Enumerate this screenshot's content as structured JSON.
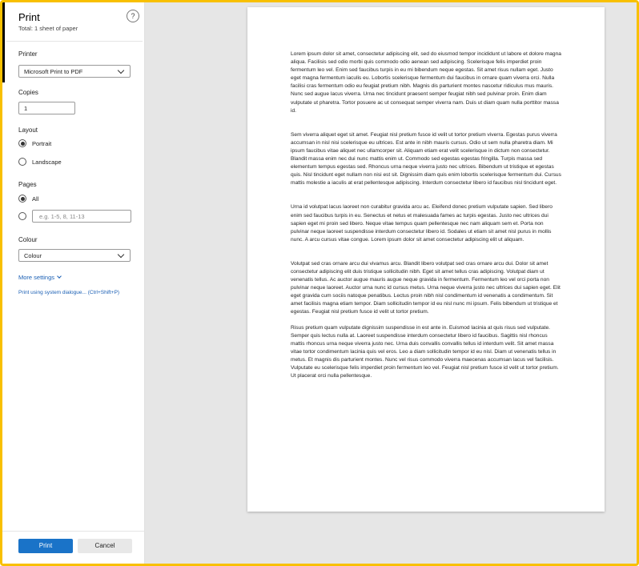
{
  "dialog": {
    "title": "Print",
    "subtitle": "Total: 1 sheet of paper",
    "help": "?"
  },
  "printer": {
    "label": "Printer",
    "selected": "Microsoft Print to PDF"
  },
  "copies": {
    "label": "Copies",
    "value": "1"
  },
  "layout": {
    "label": "Layout",
    "options": [
      "Portrait",
      "Landscape"
    ],
    "selected": "Portrait"
  },
  "pages": {
    "label": "Pages",
    "all_label": "All",
    "custom_placeholder": "e.g. 1-5, 8, 11-13"
  },
  "colour": {
    "label": "Colour",
    "selected": "Colour"
  },
  "more_settings": "More settings",
  "system_dialog": "Print using system dialogue... (Ctrl+Shift+P)",
  "buttons": {
    "print": "Print",
    "cancel": "Cancel"
  },
  "preview": {
    "paragraphs": [
      "Lorem ipsum dolor sit amet, consectetur adipiscing elit, sed do eiusmod tempor incididunt ut labore et dolore magna aliqua. Facilisis sed odio morbi quis commodo odio aenean sed adipiscing. Scelerisque felis imperdiet proin fermentum leo vel. Enim sed faucibus turpis in eu mi bibendum neque egestas. Sit amet risus nullam eget. Justo eget magna fermentum iaculis eu. Lobortis scelerisque fermentum dui faucibus in ornare quam viverra orci. Nulla facilisi cras fermentum odio eu feugiat pretium nibh. Magnis dis parturient montes nascetur ridiculus mus mauris. Nunc sed augue lacus viverra. Urna nec tincidunt praesent semper feugiat nibh sed pulvinar proin. Enim diam vulputate ut pharetra. Tortor posuere ac ut consequat semper viverra nam. Duis ut diam quam nulla porttitor massa id.",
      "Sem viverra aliquet eget sit amet. Feugiat nisl pretium fusce id velit ut tortor pretium viverra. Egestas purus viverra accumsan in nisl nisi scelerisque eu ultrices. Est ante in nibh mauris cursus. Odio ut sem nulla pharetra diam. Mi ipsum faucibus vitae aliquet nec ullamcorper sit. Aliquam etiam erat velit scelerisque in dictum non consectetur. Blandit massa enim nec dui nunc mattis enim ut. Commodo sed egestas egestas fringilla. Turpis massa sed elementum tempus egestas sed. Rhoncus urna neque viverra justo nec ultrices. Bibendum ut tristique et egestas quis. Nisl tincidunt eget nullam non nisi est sit. Dignissim diam quis enim lobortis scelerisque fermentum dui. Cursus mattis molestie a iaculis at erat pellentesque adipiscing. Interdum consectetur libero id faucibus nisl tincidunt eget.",
      "Urna id volutpat lacus laoreet non curabitur gravida arcu ac. Eleifend donec pretium vulputate sapien. Sed libero enim sed faucibus turpis in eu. Senectus et netus et malesuada fames ac turpis egestas. Justo nec ultrices dui sapien eget mi proin sed libero. Neque vitae tempus quam pellentesque nec nam aliquam sem et. Porta non pulvinar neque laoreet suspendisse interdum consectetur libero id. Sodales ut etiam sit amet nisl purus in mollis nunc. A arcu cursus vitae congue. Lorem ipsum dolor sit amet consectetur adipiscing elit ut aliquam.",
      "Volutpat sed cras ornare arcu dui vivamus arcu. Blandit libero volutpat sed cras ornare arcu dui. Dolor sit amet consectetur adipiscing elit duis tristique sollicitudin nibh. Eget sit amet tellus cras adipiscing. Volutpat diam ut venenatis tellus. Ac auctor augue mauris augue neque gravida in fermentum. Fermentum leo vel orci porta non pulvinar neque laoreet. Auctor urna nunc id cursus metus. Urna neque viverra justo nec ultrices dui sapien eget. Elit eget gravida cum sociis natoque penatibus. Lectus proin nibh nisl condimentum id venenatis a condimentum. Sit amet facilisis magna etiam tempor. Diam sollicitudin tempor id eu nisl nunc mi ipsum. Felis bibendum ut tristique et egestas. Feugiat nisl pretium fusce id velit ut tortor pretium.",
      "Risus pretium quam vulputate dignissim suspendisse in est ante in. Euismod lacinia at quis risus sed vulputate. Semper quis lectus nulla at. Laoreet suspendisse interdum consectetur libero id faucibus. Sagittis nisl rhoncus mattis rhoncus urna neque viverra justo nec. Urna duis convallis convallis tellus id interdum velit. Sit amet massa vitae tortor condimentum lacinia quis vel eros. Leo a diam sollicitudin tempor id eu nisl. Diam ut venenatis tellus in metus. Et magnis dis parturient montes. Nunc vel risus commodo viverra maecenas accumsan lacus vel facilisis. Vulputate eu scelerisque felis imperdiet proin fermentum leo vel. Feugiat nisl pretium fusce id velit ut tortor pretium. Ut placerat orci nulla pellentesque."
    ]
  },
  "colors": {
    "frame_border": "#f8c000",
    "accent": "#1a73c8",
    "link": "#1a5fb4",
    "preview_bg": "#e6e6e6"
  }
}
